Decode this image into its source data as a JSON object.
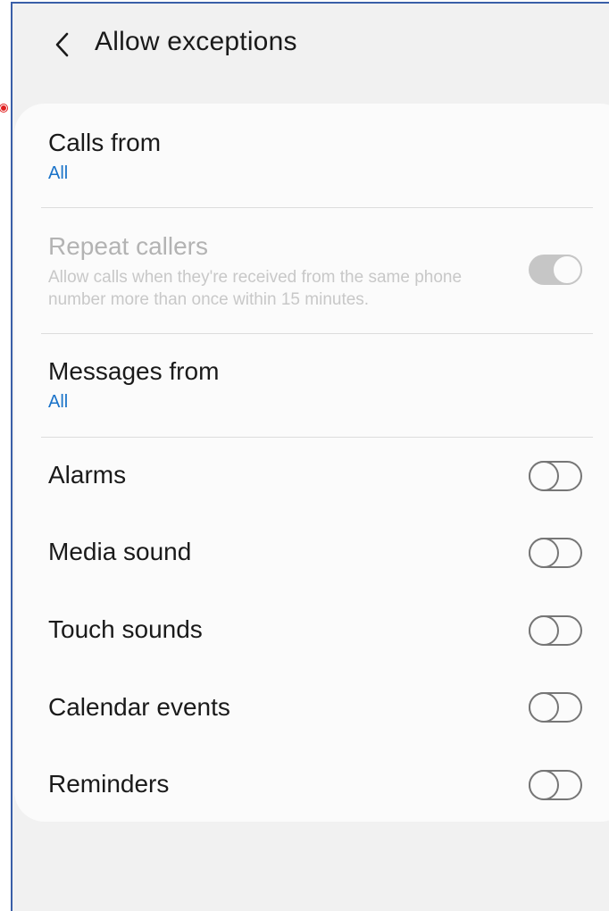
{
  "header": {
    "title": "Allow exceptions",
    "back_icon": "chevron-left-icon"
  },
  "calls_from": {
    "label": "Calls from",
    "value": "All"
  },
  "repeat_callers": {
    "label": "Repeat callers",
    "description": "Allow calls when they're received from the same phone number more than once within 15 minutes.",
    "enabled": false,
    "checked": true
  },
  "messages_from": {
    "label": "Messages from",
    "value": "All"
  },
  "toggles": [
    {
      "label": "Alarms",
      "checked": false
    },
    {
      "label": "Media sound",
      "checked": false
    },
    {
      "label": "Touch sounds",
      "checked": false
    },
    {
      "label": "Calendar events",
      "checked": false
    },
    {
      "label": "Reminders",
      "checked": false
    }
  ],
  "colors": {
    "accent": "#1a73c9",
    "background": "#f1f1f1",
    "card": "#fbfbfb",
    "frame_border": "#3a5fa8"
  }
}
